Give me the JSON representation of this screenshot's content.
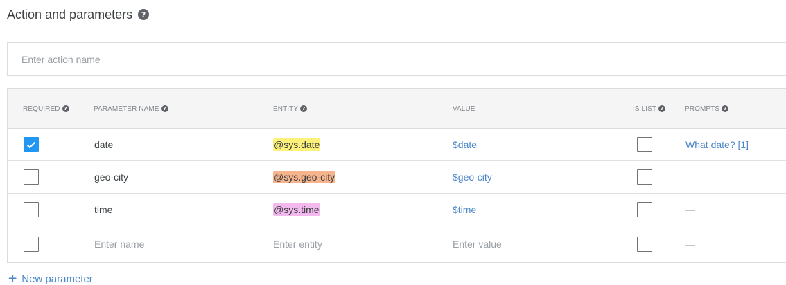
{
  "section": {
    "title": "Action and parameters",
    "help_icon": "?"
  },
  "action_input": {
    "placeholder": "Enter action name",
    "value": ""
  },
  "columns": {
    "required": "REQUIRED",
    "parameter_name": "PARAMETER NAME",
    "entity": "ENTITY",
    "value": "VALUE",
    "is_list": "IS LIST",
    "prompts": "PROMPTS"
  },
  "rows": [
    {
      "required": true,
      "name": "date",
      "entity": "@sys.date",
      "entity_color": "#fdf17a",
      "value": "$date",
      "is_list": false,
      "prompts": "What date? [1]"
    },
    {
      "required": false,
      "name": "geo-city",
      "entity": "@sys.geo-city",
      "entity_color": "#f5b48c",
      "value": "$geo-city",
      "is_list": false,
      "prompts": "—"
    },
    {
      "required": false,
      "name": "time",
      "entity": "@sys.time",
      "entity_color": "#f3b8ee",
      "value": "$time",
      "is_list": false,
      "prompts": "—"
    }
  ],
  "new_row": {
    "name_placeholder": "Enter name",
    "entity_placeholder": "Enter entity",
    "value_placeholder": "Enter value",
    "prompts": "—"
  },
  "new_parameter": {
    "icon": "+",
    "label": "New parameter"
  },
  "colors": {
    "accent": "#4a86c8",
    "checkbox_checked": "#2196f3",
    "header_bg": "#f5f5f5"
  }
}
